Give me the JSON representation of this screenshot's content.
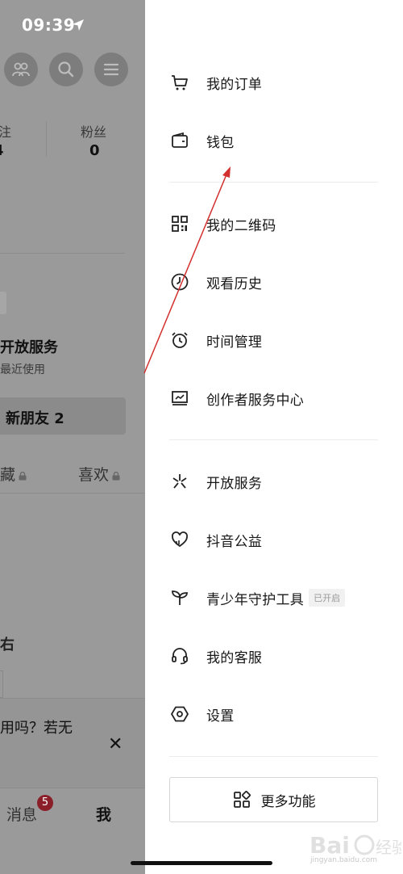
{
  "status_bar": {
    "time": "09:39"
  },
  "background": {
    "stats": [
      {
        "label": "注",
        "value": "4"
      },
      {
        "label": "粉丝",
        "value": "0"
      }
    ],
    "open_services": "开放服务",
    "recently_used": "最近使用",
    "new_friends": "新朋友 2",
    "tabs": {
      "favorites": "藏",
      "likes": "喜欢"
    },
    "edge_char": "右",
    "banner_text": "用吗？若无",
    "bottom_nav": {
      "messages": "消息",
      "messages_badge": "5",
      "me": "我"
    }
  },
  "drawer": {
    "items": [
      {
        "label": "我的订单",
        "icon": "cart-icon"
      },
      {
        "label": "钱包",
        "icon": "wallet-icon"
      },
      {
        "label": "我的二维码",
        "icon": "qr-code-icon"
      },
      {
        "label": "观看历史",
        "icon": "history-icon"
      },
      {
        "label": "时间管理",
        "icon": "alarm-clock-icon"
      },
      {
        "label": "创作者服务中心",
        "icon": "creator-monitor-icon"
      },
      {
        "label": "开放服务",
        "icon": "open-service-icon"
      },
      {
        "label": "抖音公益",
        "icon": "charity-heart-icon"
      },
      {
        "label": "青少年守护工具",
        "icon": "sprout-icon",
        "tag": "已开启"
      },
      {
        "label": "我的客服",
        "icon": "headset-icon"
      },
      {
        "label": "设置",
        "icon": "settings-hexagon-icon"
      }
    ],
    "more_button": "更多功能"
  },
  "watermark": "jingyan.baidu.com",
  "colors": {
    "dim_overlay": "#9a9a9a",
    "badge": "#8a1f2a",
    "annotation_arrow": "#d32f2f",
    "divider": "#ececec"
  }
}
